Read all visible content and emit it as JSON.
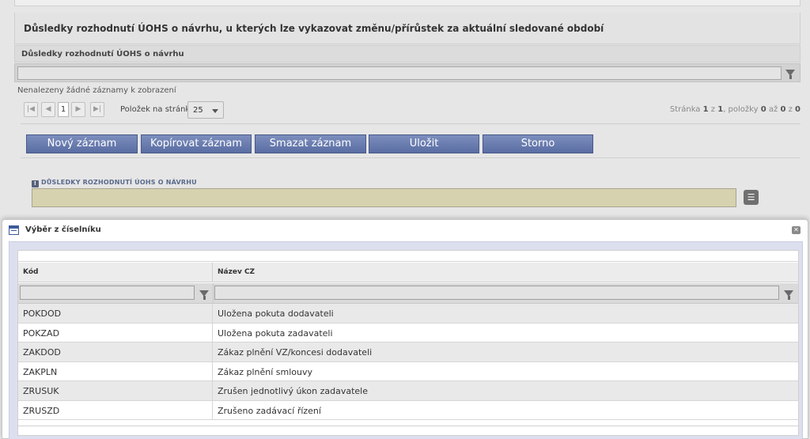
{
  "section": {
    "title": "Důsledky rozhodnutí ÚOHS o návrhu, u kterých lze vykazovat změnu/přírůstek za aktuální sledované období",
    "grid_column": "Důsledky rozhodnutí ÚOHS o návrhu",
    "empty_message": "Nenalezeny žádné záznamy k zobrazení"
  },
  "pager": {
    "current_page": "1",
    "per_page_label": "Položek na stránku",
    "per_page_value": "25",
    "info_prefix": "Stránka",
    "info_page": "1",
    "info_of": "z",
    "info_total_pages": "1",
    "info_items": ", položky",
    "info_from": "0",
    "info_to_word": "až",
    "info_to": "0",
    "info_z2": "z",
    "info_count": "0"
  },
  "toolbar": {
    "new": "Nový záznam",
    "copy": "Kopírovat záznam",
    "delete": "Smazat záznam",
    "save": "Uložit",
    "cancel": "Storno"
  },
  "field": {
    "label": "DŮSLEDKY ROZHODNUTÍ ÚOHS O NÁVRHU",
    "required_mark": "!"
  },
  "modal": {
    "title": "Výběr z číselníku",
    "close_glyph": "✕",
    "columns": {
      "code": "Kód",
      "name": "Název CZ"
    },
    "rows": [
      {
        "code": "POKDOD",
        "name": "Uložena pokuta dodavateli"
      },
      {
        "code": "POKZAD",
        "name": "Uložena pokuta zadavateli"
      },
      {
        "code": "ZAKDOD",
        "name": "Zákaz plnění VZ/koncesi dodavateli"
      },
      {
        "code": "ZAKPLN",
        "name": "Zákaz plnění smlouvy"
      },
      {
        "code": "ZRUSUK",
        "name": "Zrušen jednotlivý úkon zadavatele"
      },
      {
        "code": "ZRUSZD",
        "name": "Zrušeno zadávací řízení"
      }
    ]
  },
  "icons": {
    "first": "first-page-icon",
    "prev": "prev-page-icon",
    "next": "next-page-icon",
    "last": "last-page-icon",
    "filter": "filter-funnel-icon",
    "list": "list-icon",
    "window": "window-icon",
    "close": "close-icon"
  },
  "colors": {
    "action_button": "#6678ad",
    "field_input": "#d6d2b0",
    "modal_body": "#dcdfee"
  }
}
